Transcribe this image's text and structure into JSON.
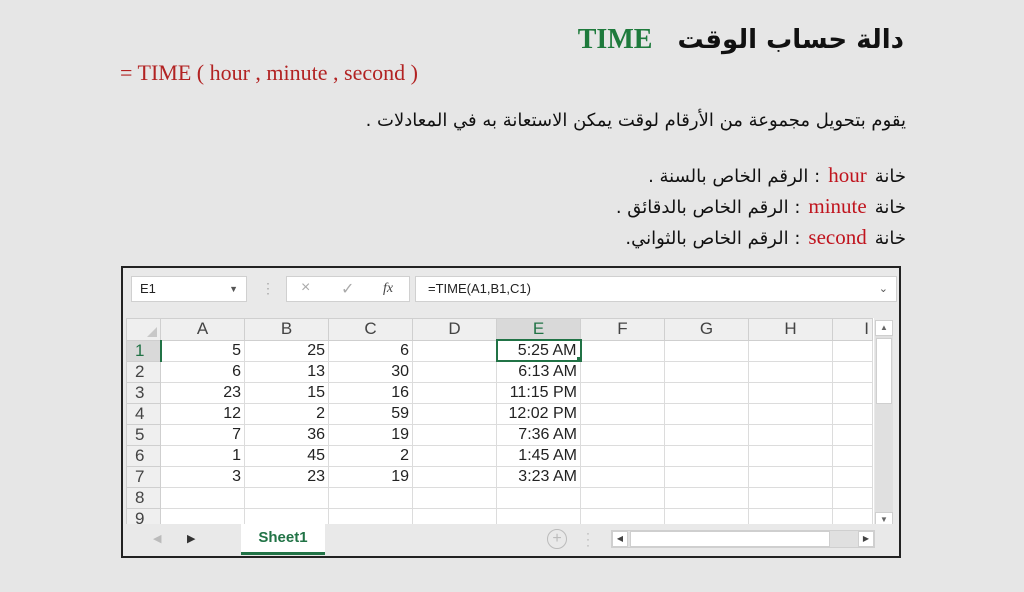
{
  "title": {
    "arabic": "دالة حساب الوقت",
    "function_name": "TIME",
    "function_color": "#1e7a3c"
  },
  "syntax": "= TIME ( hour , minute , second )",
  "description": "يقوم بتحويل مجموعة من الأرقام لوقت يمكن الاستعانة به في المعادلات .",
  "arguments": [
    {
      "prefix": "خانة",
      "keyword": "hour",
      "text": ": الرقم الخاص بالسنة ."
    },
    {
      "prefix": "خانة",
      "keyword": "minute",
      "text": ": الرقم الخاص بالدقائق ."
    },
    {
      "prefix": "خانة",
      "keyword": "second",
      "text": ": الرقم الخاص بالثواني."
    }
  ],
  "excel": {
    "name_box": "E1",
    "formula": "=TIME(A1,B1,C1)",
    "icons": {
      "cancel": "×",
      "enter": "✓",
      "fx": "fx"
    },
    "columns": [
      "A",
      "B",
      "C",
      "D",
      "E",
      "F",
      "G",
      "H",
      "I"
    ],
    "selected_column": "E",
    "rows": [
      {
        "num": "1",
        "cells": [
          "5",
          "25",
          "6",
          "",
          "5:25 AM",
          "",
          "",
          "",
          ""
        ]
      },
      {
        "num": "2",
        "cells": [
          "6",
          "13",
          "30",
          "",
          "6:13 AM",
          "",
          "",
          "",
          ""
        ]
      },
      {
        "num": "3",
        "cells": [
          "23",
          "15",
          "16",
          "",
          "11:15 PM",
          "",
          "",
          "",
          ""
        ]
      },
      {
        "num": "4",
        "cells": [
          "12",
          "2",
          "59",
          "",
          "12:02 PM",
          "",
          "",
          "",
          ""
        ]
      },
      {
        "num": "5",
        "cells": [
          "7",
          "36",
          "19",
          "",
          "7:36 AM",
          "",
          "",
          "",
          ""
        ]
      },
      {
        "num": "6",
        "cells": [
          "1",
          "45",
          "2",
          "",
          "1:45 AM",
          "",
          "",
          "",
          ""
        ]
      },
      {
        "num": "7",
        "cells": [
          "3",
          "23",
          "19",
          "",
          "3:23 AM",
          "",
          "",
          "",
          ""
        ]
      },
      {
        "num": "8",
        "cells": [
          "",
          "",
          "",
          "",
          "",
          "",
          "",
          "",
          ""
        ]
      },
      {
        "num": "9",
        "cells": [
          "",
          "",
          "",
          "",
          "",
          "",
          "",
          "",
          ""
        ]
      }
    ],
    "sheet_tab": "Sheet1",
    "accent_color": "#217346"
  }
}
